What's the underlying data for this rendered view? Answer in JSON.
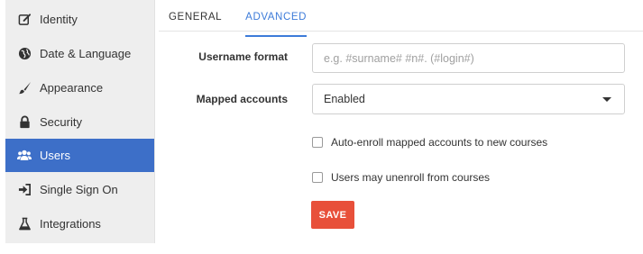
{
  "sidebar": {
    "items": [
      {
        "label": "Identity",
        "icon": "edit-icon"
      },
      {
        "label": "Date & Language",
        "icon": "globe-icon"
      },
      {
        "label": "Appearance",
        "icon": "brush-icon"
      },
      {
        "label": "Security",
        "icon": "lock-icon"
      },
      {
        "label": "Users",
        "icon": "users-icon",
        "active": true
      },
      {
        "label": "Single Sign On",
        "icon": "sign-in-icon"
      },
      {
        "label": "Integrations",
        "icon": "flask-icon"
      }
    ]
  },
  "tabs": [
    {
      "label": "GENERAL",
      "active": false
    },
    {
      "label": "ADVANCED",
      "active": true
    }
  ],
  "form": {
    "username_format": {
      "label": "Username format",
      "placeholder": "e.g. #surname# #n#. (#login#)",
      "value": ""
    },
    "mapped_accounts": {
      "label": "Mapped accounts",
      "selected": "Enabled"
    },
    "checkboxes": [
      {
        "label": "Auto-enroll mapped accounts to new courses",
        "checked": false
      },
      {
        "label": "Users may unenroll from courses",
        "checked": false
      }
    ],
    "save_label": "SAVE"
  },
  "colors": {
    "active_sidebar": "#3d6fc8",
    "tab_accent": "#3d7bd9",
    "save_button": "#e8503a",
    "sidebar_bg": "#eeeeee"
  }
}
